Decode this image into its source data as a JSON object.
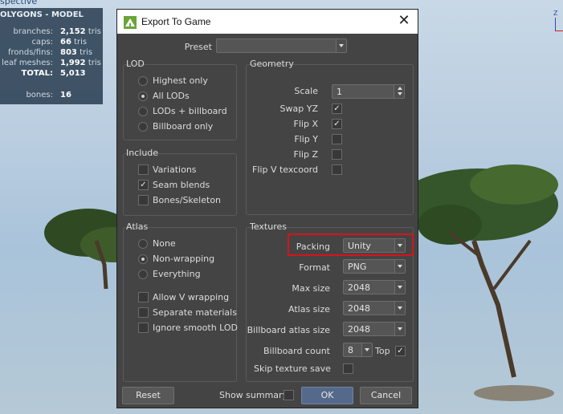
{
  "viewport": {
    "perspective_label": "spective",
    "hud": {
      "title": "OLYGONS - MODEL",
      "rows": [
        {
          "key": "branches:",
          "value": "2,152",
          "unit": "tris"
        },
        {
          "key": "caps:",
          "value": "66",
          "unit": "tris"
        },
        {
          "key": "fronds/fins:",
          "value": "803",
          "unit": "tris"
        },
        {
          "key": "leaf meshes:",
          "value": "1,992",
          "unit": "tris"
        },
        {
          "key": "TOTAL:",
          "value": "5,013",
          "unit": ""
        },
        {
          "key": "bones:",
          "value": "16",
          "unit": ""
        }
      ]
    },
    "axis_label": "Z"
  },
  "dialog": {
    "title": "Export To Game",
    "close_glyph": "✕",
    "preset": {
      "label": "Preset",
      "value": ""
    },
    "lod": {
      "title": "LOD",
      "options": [
        "Highest only",
        "All LODs",
        "LODs + billboard",
        "Billboard only"
      ],
      "selected": 1
    },
    "include": {
      "title": "Include",
      "items": [
        {
          "label": "Variations",
          "checked": false
        },
        {
          "label": "Seam blends",
          "checked": true
        },
        {
          "label": "Bones/Skeleton",
          "checked": false
        }
      ]
    },
    "atlas": {
      "title": "Atlas",
      "options": [
        "None",
        "Non-wrapping",
        "Everything"
      ],
      "selected": 1,
      "checks": [
        {
          "label": "Allow V wrapping",
          "checked": false
        },
        {
          "label": "Separate materials",
          "checked": false
        },
        {
          "label": "Ignore smooth LOD",
          "checked": false
        }
      ]
    },
    "geometry": {
      "title": "Geometry",
      "scale_label": "Scale",
      "scale_value": "1",
      "checks": [
        {
          "label": "Swap YZ",
          "checked": true
        },
        {
          "label": "Flip X",
          "checked": true
        },
        {
          "label": "Flip Y",
          "checked": false
        },
        {
          "label": "Flip Z",
          "checked": false
        },
        {
          "label": "Flip V texcoord",
          "checked": false
        }
      ]
    },
    "textures": {
      "title": "Textures",
      "packing_label": "Packing",
      "packing_value": "Unity",
      "format_label": "Format",
      "format_value": "PNG",
      "max_size_label": "Max size",
      "max_size_value": "2048",
      "atlas_size_label": "Atlas size",
      "atlas_size_value": "2048",
      "billboard_atlas_label": "Billboard atlas size",
      "billboard_atlas_value": "2048",
      "billboard_count_label": "Billboard count",
      "billboard_count_value": "8",
      "top_label": "Top",
      "top_checked": true,
      "skip_label": "Skip texture save",
      "skip_checked": false
    },
    "footer": {
      "reset": "Reset",
      "show_summary": "Show summary",
      "show_summary_checked": false,
      "ok": "OK",
      "cancel": "Cancel"
    },
    "highlight_color": "#d4141b"
  }
}
